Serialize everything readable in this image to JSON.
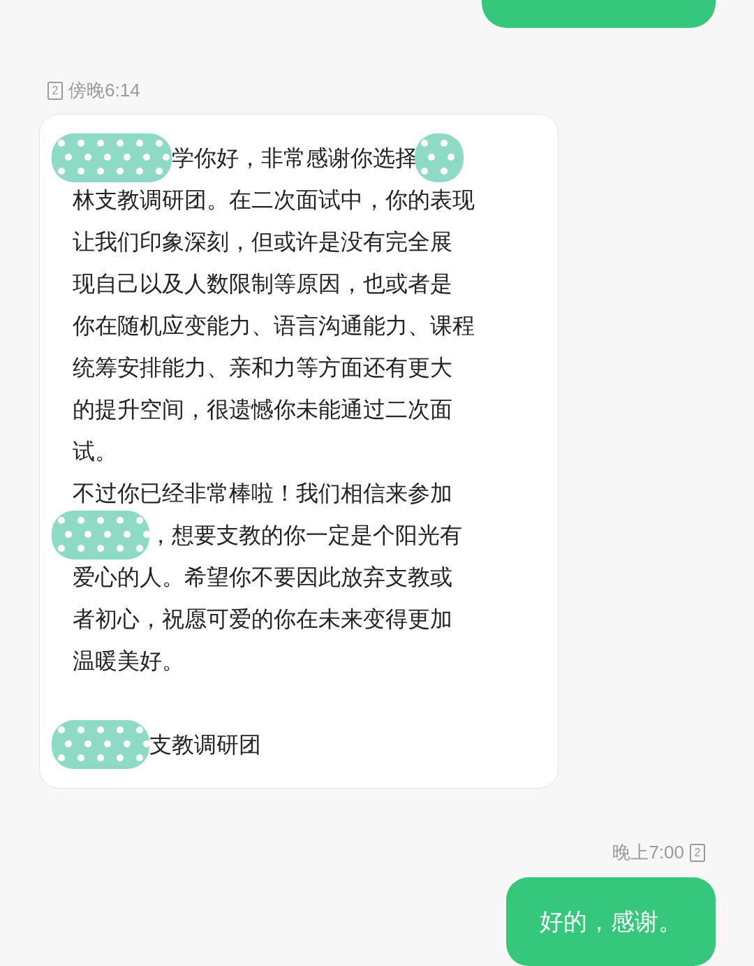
{
  "top_bubble": {
    "kind": "outgoing"
  },
  "incoming": {
    "sim": "2",
    "time": "傍晚6:14",
    "blocks": [
      {
        "lines": [
          {
            "text": "学你好，非常感谢你选择",
            "redacted_before": true,
            "redacted_after": true
          },
          {
            "text": "林支教调研团。在二次面试中，你的表现",
            "redacted_before": false,
            "redacted_after": false
          },
          {
            "text": "让我们印象深刻，但或许是没有完全展",
            "redacted_before": false,
            "redacted_after": false
          },
          {
            "text": "现自己以及人数限制等原因，也或者是",
            "redacted_before": false,
            "redacted_after": false
          },
          {
            "text": "你在随机应变能力、语言沟通能力、课程",
            "redacted_before": false,
            "redacted_after": false
          },
          {
            "text": "统筹安排能力、亲和力等方面还有更大",
            "redacted_before": false,
            "redacted_after": false
          },
          {
            "text": "的提升空间，很遗憾你未能通过二次面",
            "redacted_before": false,
            "redacted_after": false
          },
          {
            "text": "试。",
            "redacted_before": false,
            "redacted_after": false
          },
          {
            "text": "不过你已经非常棒啦！我们相信来参加",
            "redacted_before": false,
            "redacted_after": false
          },
          {
            "text": "，想要支教的你一定是个阳光有",
            "redacted_before": true,
            "redacted_after": false
          },
          {
            "text": "爱心的人。希望你不要因此放弃支教或",
            "redacted_before": false,
            "redacted_after": false
          },
          {
            "text": "者初心，祝愿可爱的你在未来变得更加",
            "redacted_before": false,
            "redacted_after": false
          },
          {
            "text": "温暖美好。",
            "redacted_before": false,
            "redacted_after": false
          }
        ]
      },
      {
        "lines": [
          {
            "text": "支教调研团",
            "redacted_before": true,
            "redacted_after": false
          }
        ]
      }
    ]
  },
  "outgoing": {
    "time": "晚上7:00",
    "sim": "2",
    "text": "好的，感谢。"
  }
}
